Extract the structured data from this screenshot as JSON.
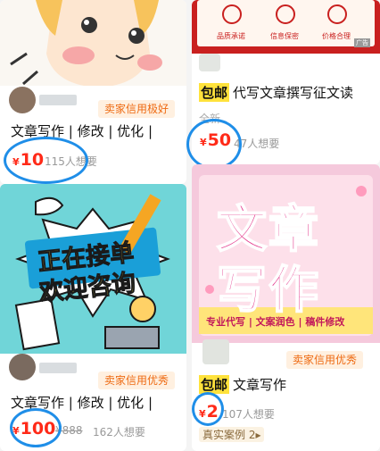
{
  "cards": [
    {
      "badge": "卖家信用极好",
      "title": "文章写作 | 修改 | 优化 |",
      "price": "10",
      "want": "115人想要"
    },
    {
      "banner_icons": [
        "品质承诺",
        "信息保密",
        "价格合理"
      ],
      "ad_tag": "广告",
      "baoyou": "包邮",
      "title": "代写文章撰写征文读",
      "condition": "全新",
      "price": "50",
      "want": "47人想要"
    },
    {
      "poster_line1": "正在接单",
      "poster_line2": "欢迎咨询",
      "badge": "卖家信用优秀",
      "title": "文章写作 | 修改 | 优化 |",
      "price": "100",
      "original_price": "¥888",
      "want": "162人想要"
    },
    {
      "poster_big1": "文章",
      "poster_big2": "写作",
      "poster_strip": "专业代写 | 文案润色 | 稿件修改",
      "badge": "卖家信用优秀",
      "baoyou": "包邮",
      "title": "文章写作",
      "price": "2",
      "want": "107人想要",
      "case_label": "真实案例 2",
      "case_arrow": "▸"
    }
  ],
  "currency": "¥",
  "colors": {
    "price": "#ff2a18",
    "badge_text": "#ee6a12",
    "badge_bg": "#fff0e0",
    "highlight_ring": "#1f8ee8",
    "baoyou_bg": "#ffe23c"
  }
}
